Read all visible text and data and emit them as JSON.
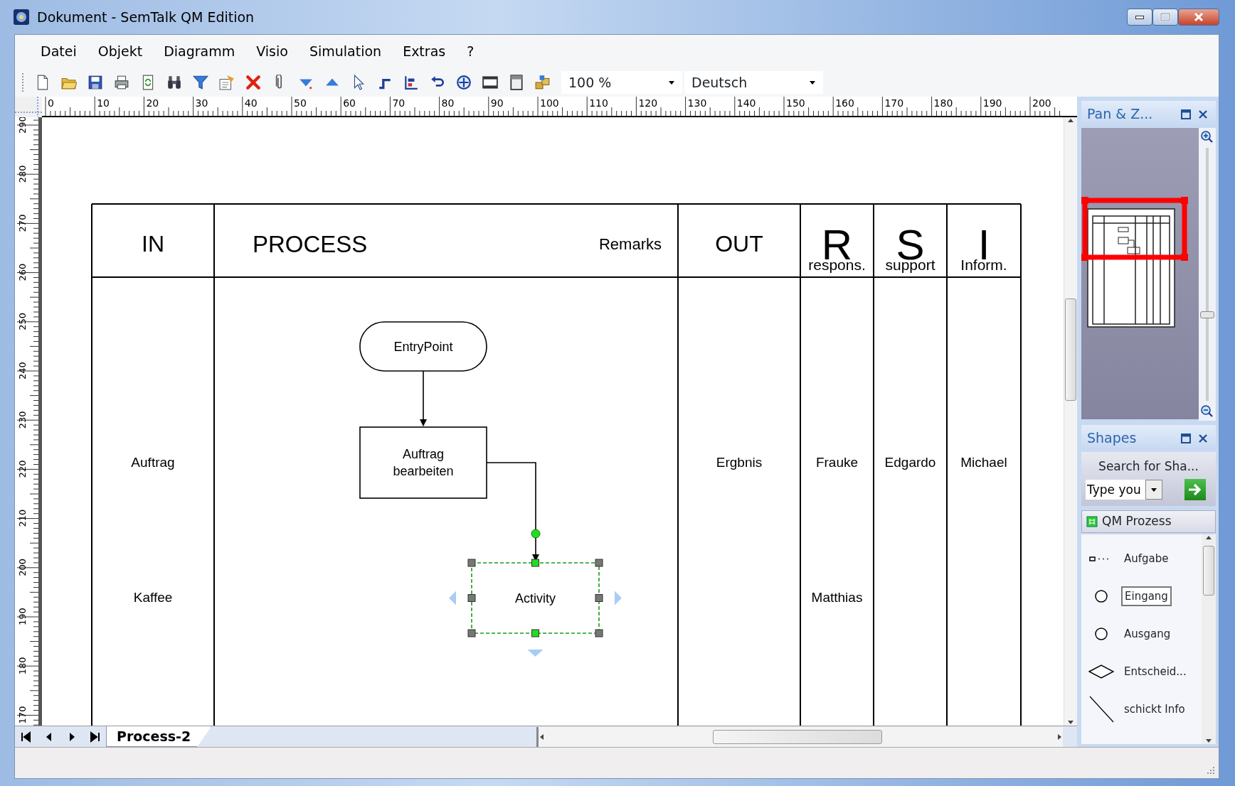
{
  "window": {
    "title": "Dokument - SemTalk QM Edition"
  },
  "menu": [
    "Datei",
    "Objekt",
    "Diagramm",
    "Visio",
    "Simulation",
    "Extras",
    "?"
  ],
  "toolbar": {
    "zoom": "100 %",
    "language": "Deutsch"
  },
  "rulers": {
    "horizontal": [
      "0",
      "10",
      "20",
      "30",
      "40",
      "50",
      "60",
      "70",
      "80",
      "90",
      "100",
      "110",
      "120",
      "130",
      "140",
      "150",
      "160",
      "170",
      "180",
      "190",
      "200"
    ],
    "vertical": [
      "290",
      "280",
      "270",
      "260",
      "250",
      "240",
      "230",
      "220",
      "210",
      "200",
      "190",
      "180",
      "170"
    ]
  },
  "diagram": {
    "columns": [
      {
        "kind": "plain",
        "label": "IN"
      },
      {
        "kind": "process",
        "label": "PROCESS",
        "remark": "Remarks"
      },
      {
        "kind": "plain",
        "label": "OUT"
      },
      {
        "kind": "role",
        "letter": "R",
        "label": "respons."
      },
      {
        "kind": "role",
        "letter": "S",
        "label": "support"
      },
      {
        "kind": "role",
        "letter": "I",
        "label": "Inform."
      }
    ],
    "rows": [
      {
        "in": "Auftrag",
        "out": "Ergbnis",
        "responsible": "Frauke",
        "support": "Edgardo",
        "inform": "Michael"
      },
      {
        "in": "Kaffee",
        "responsible": "Matthias"
      }
    ],
    "shapes": [
      {
        "kind": "start",
        "label": "EntryPoint",
        "selected": false
      },
      {
        "kind": "task",
        "label": "Auftrag bearbeiten",
        "selected": false
      },
      {
        "kind": "task",
        "label": "Activity",
        "selected": true
      }
    ]
  },
  "pages": [
    {
      "label": "Process-2",
      "selected": true
    }
  ],
  "pan_zoom": {
    "title": "Pan & Z...",
    "zoom_slider": {
      "level": 0.34
    }
  },
  "shapes_panel": {
    "title": "Shapes",
    "search_label": "Search for Sha...",
    "search": {
      "placeholder": "Type you"
    },
    "stencil": "QM Prozess",
    "items": [
      {
        "kind": "task",
        "label": "Aufgabe",
        "selected": false
      },
      {
        "kind": "circle",
        "label": "Eingang",
        "selected": true
      },
      {
        "kind": "circle",
        "label": "Ausgang",
        "selected": false
      },
      {
        "kind": "diamond",
        "label": "Entscheid...",
        "selected": false
      },
      {
        "kind": "line",
        "label": "schickt Info",
        "selected": false
      }
    ]
  }
}
